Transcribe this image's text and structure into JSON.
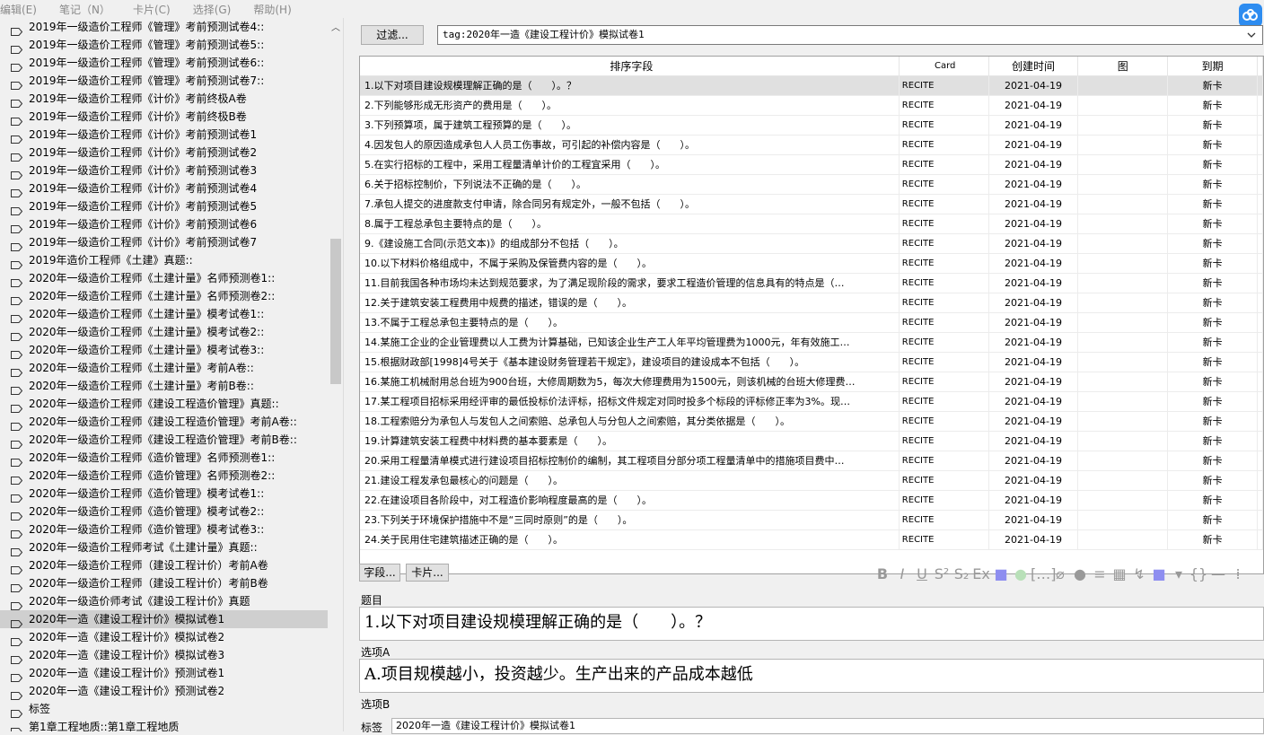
{
  "menu": [
    "编辑(E)",
    "笔记（N）",
    "卡片(C)",
    "选择(G)",
    "帮助(H)"
  ],
  "sidebar": {
    "items": [
      "2019年一级造价工程师《管理》考前预测试卷4::",
      "2019年一级造价工程师《管理》考前预测试卷5::",
      "2019年一级造价工程师《管理》考前预测试卷6::",
      "2019年一级造价工程师《管理》考前预测试卷7::",
      "2019年一级造价工程师《计价》考前终极A卷",
      "2019年一级造价工程师《计价》考前终极B卷",
      "2019年一级造价工程师《计价》考前预测试卷1",
      "2019年一级造价工程师《计价》考前预测试卷2",
      "2019年一级造价工程师《计价》考前预测试卷3",
      "2019年一级造价工程师《计价》考前预测试卷4",
      "2019年一级造价工程师《计价》考前预测试卷5",
      "2019年一级造价工程师《计价》考前预测试卷6",
      "2019年一级造价工程师《计价》考前预测试卷7",
      "2019年造价工程师《土建》真题::",
      "2020年一级造价工程师《土建计量》名师预测卷1::",
      "2020年一级造价工程师《土建计量》名师预测卷2::",
      "2020年一级造价工程师《土建计量》模考试卷1::",
      "2020年一级造价工程师《土建计量》模考试卷2::",
      "2020年一级造价工程师《土建计量》模考试卷3::",
      "2020年一级造价工程师《土建计量》考前A卷::",
      "2020年一级造价工程师《土建计量》考前B卷::",
      "2020年一级造价工程师《建设工程造价管理》真题::",
      "2020年一级造价工程师《建设工程造价管理》考前A卷::",
      "2020年一级造价工程师《建设工程造价管理》考前B卷::",
      "2020年一级造价工程师《造价管理》名师预测卷1::",
      "2020年一级造价工程师《造价管理》名师预测卷2::",
      "2020年一级造价工程师《造价管理》模考试卷1::",
      "2020年一级造价工程师《造价管理》模考试卷2::",
      "2020年一级造价工程师《造价管理》模考试卷3::",
      "2020年一级造价工程师考试《土建计量》真题::",
      "2020年一级造价工程师（建设工程计价）考前A卷",
      "2020年一级造价工程师（建设工程计价）考前B卷",
      "2020年一级造价师考试《建设工程计价》真题",
      "2020年一造《建设工程计价》模拟试卷1",
      "2020年一造《建设工程计价》模拟试卷2",
      "2020年一造《建设工程计价》模拟试卷3",
      "2020年一造《建设工程计价》预测试卷1",
      "2020年一造《建设工程计价》预测试卷2",
      "标签",
      "第1章工程地质::第1章工程地质"
    ],
    "selected_index": 33
  },
  "filter_button": "过滤...",
  "search_query": "tag:2020年一造《建设工程计价》模拟试卷1",
  "grid": {
    "columns": [
      "排序字段",
      "Card",
      "创建时间",
      "图",
      "到期"
    ],
    "rows": [
      {
        "sort": "1.以下对项目建设规模理解正确的是（　　）。？",
        "card": "RECITE",
        "created": "2021-04-19",
        "pic": "",
        "due": "新卡"
      },
      {
        "sort": "2.下列能够形成无形资产的费用是（　　）。",
        "card": "RECITE",
        "created": "2021-04-19",
        "pic": "",
        "due": "新卡"
      },
      {
        "sort": "3.下列预算项，属于建筑工程预算的是（　　）。",
        "card": "RECITE",
        "created": "2021-04-19",
        "pic": "",
        "due": "新卡"
      },
      {
        "sort": "4.因发包人的原因造成承包人人员工伤事故，可引起的补偿内容是（　　）。",
        "card": "RECITE",
        "created": "2021-04-19",
        "pic": "",
        "due": "新卡"
      },
      {
        "sort": "5.在实行招标的工程中，采用工程量清单计价的工程宜采用（　　）。",
        "card": "RECITE",
        "created": "2021-04-19",
        "pic": "",
        "due": "新卡"
      },
      {
        "sort": "6.关于招标控制价，下列说法不正确的是（　　）。",
        "card": "RECITE",
        "created": "2021-04-19",
        "pic": "",
        "due": "新卡"
      },
      {
        "sort": "7.承包人提交的进度款支付申请，除合同另有规定外，一般不包括（　　）。",
        "card": "RECITE",
        "created": "2021-04-19",
        "pic": "",
        "due": "新卡"
      },
      {
        "sort": "8.属于工程总承包主要特点的是（　　）。",
        "card": "RECITE",
        "created": "2021-04-19",
        "pic": "",
        "due": "新卡"
      },
      {
        "sort": "9.《建设施工合同(示范文本)》的组成部分不包括（　　）。",
        "card": "RECITE",
        "created": "2021-04-19",
        "pic": "",
        "due": "新卡"
      },
      {
        "sort": "10.以下材料价格组成中，不属于采购及保管费内容的是（　　）。",
        "card": "RECITE",
        "created": "2021-04-19",
        "pic": "",
        "due": "新卡"
      },
      {
        "sort": "11.目前我国各种市场均未达到规范要求，为了满足现阶段的需求，要求工程造价管理的信息具有的特点是（…",
        "card": "RECITE",
        "created": "2021-04-19",
        "pic": "",
        "due": "新卡"
      },
      {
        "sort": "12.关于建筑安装工程费用中规费的描述，错误的是（　　）。",
        "card": "RECITE",
        "created": "2021-04-19",
        "pic": "",
        "due": "新卡"
      },
      {
        "sort": "13.不属于工程总承包主要特点的是（　　）。",
        "card": "RECITE",
        "created": "2021-04-19",
        "pic": "",
        "due": "新卡"
      },
      {
        "sort": "14.某施工企业的企业管理费以人工费为计算基础，已知该企业生产工人年平均管理费为1000元，年有效施工…",
        "card": "RECITE",
        "created": "2021-04-19",
        "pic": "",
        "due": "新卡"
      },
      {
        "sort": "15.根据财政部[1998]4号关于《基本建设财务管理若干规定》，建设项目的建设成本不包括（　　）。",
        "card": "RECITE",
        "created": "2021-04-19",
        "pic": "",
        "due": "新卡"
      },
      {
        "sort": "16.某施工机械耐用总台班为900台班，大修周期数为5，每次大修理费用为1500元，则该机械的台班大修理费…",
        "card": "RECITE",
        "created": "2021-04-19",
        "pic": "",
        "due": "新卡"
      },
      {
        "sort": "17.某工程项目招标采用经评审的最低投标价法评标，招标文件规定对同时投多个标段的评标修正率为3%。现…",
        "card": "RECITE",
        "created": "2021-04-19",
        "pic": "",
        "due": "新卡"
      },
      {
        "sort": "18.工程索赔分为承包人与发包人之间索赔、总承包人与分包人之间索赔，其分类依据是（　　）。",
        "card": "RECITE",
        "created": "2021-04-19",
        "pic": "",
        "due": "新卡"
      },
      {
        "sort": "19.计算建筑安装工程费中材料费的基本要素是（　　）。",
        "card": "RECITE",
        "created": "2021-04-19",
        "pic": "",
        "due": "新卡"
      },
      {
        "sort": "20.采用工程量清单模式进行建设项目招标控制价的编制，其工程项目分部分项工程量清单中的措施项目费中…",
        "card": "RECITE",
        "created": "2021-04-19",
        "pic": "",
        "due": "新卡"
      },
      {
        "sort": "21.建设工程发承包最核心的问题是（　　）。",
        "card": "RECITE",
        "created": "2021-04-19",
        "pic": "",
        "due": "新卡"
      },
      {
        "sort": "22.在建设项目各阶段中，对工程造价影响程度最高的是（　　）。",
        "card": "RECITE",
        "created": "2021-04-19",
        "pic": "",
        "due": "新卡"
      },
      {
        "sort": "23.下列关于环境保护措施中不是“三同时原则”的是（　　）。",
        "card": "RECITE",
        "created": "2021-04-19",
        "pic": "",
        "due": "新卡"
      },
      {
        "sort": "24.关于民用住宅建筑描述正确的是（　　）。",
        "card": "RECITE",
        "created": "2021-04-19",
        "pic": "",
        "due": "新卡"
      }
    ],
    "selected_index": 0
  },
  "editor": {
    "field_button": "字段...",
    "card_button": "卡片...",
    "fields": [
      {
        "label": "题目",
        "value": "1.以下对项目建设规模理解正确的是（　　）。？"
      },
      {
        "label": "选项A",
        "value": "A.项目规模越小，投资越少。生产出来的产品成本越低"
      },
      {
        "label": "选项B",
        "value": ""
      }
    ],
    "tags_label": "标签",
    "tags_value": "2020年一造《建设工程计价》模拟试卷1"
  },
  "colors": {
    "selection": "#cfcfcf",
    "accent": "#2d8cf0"
  }
}
